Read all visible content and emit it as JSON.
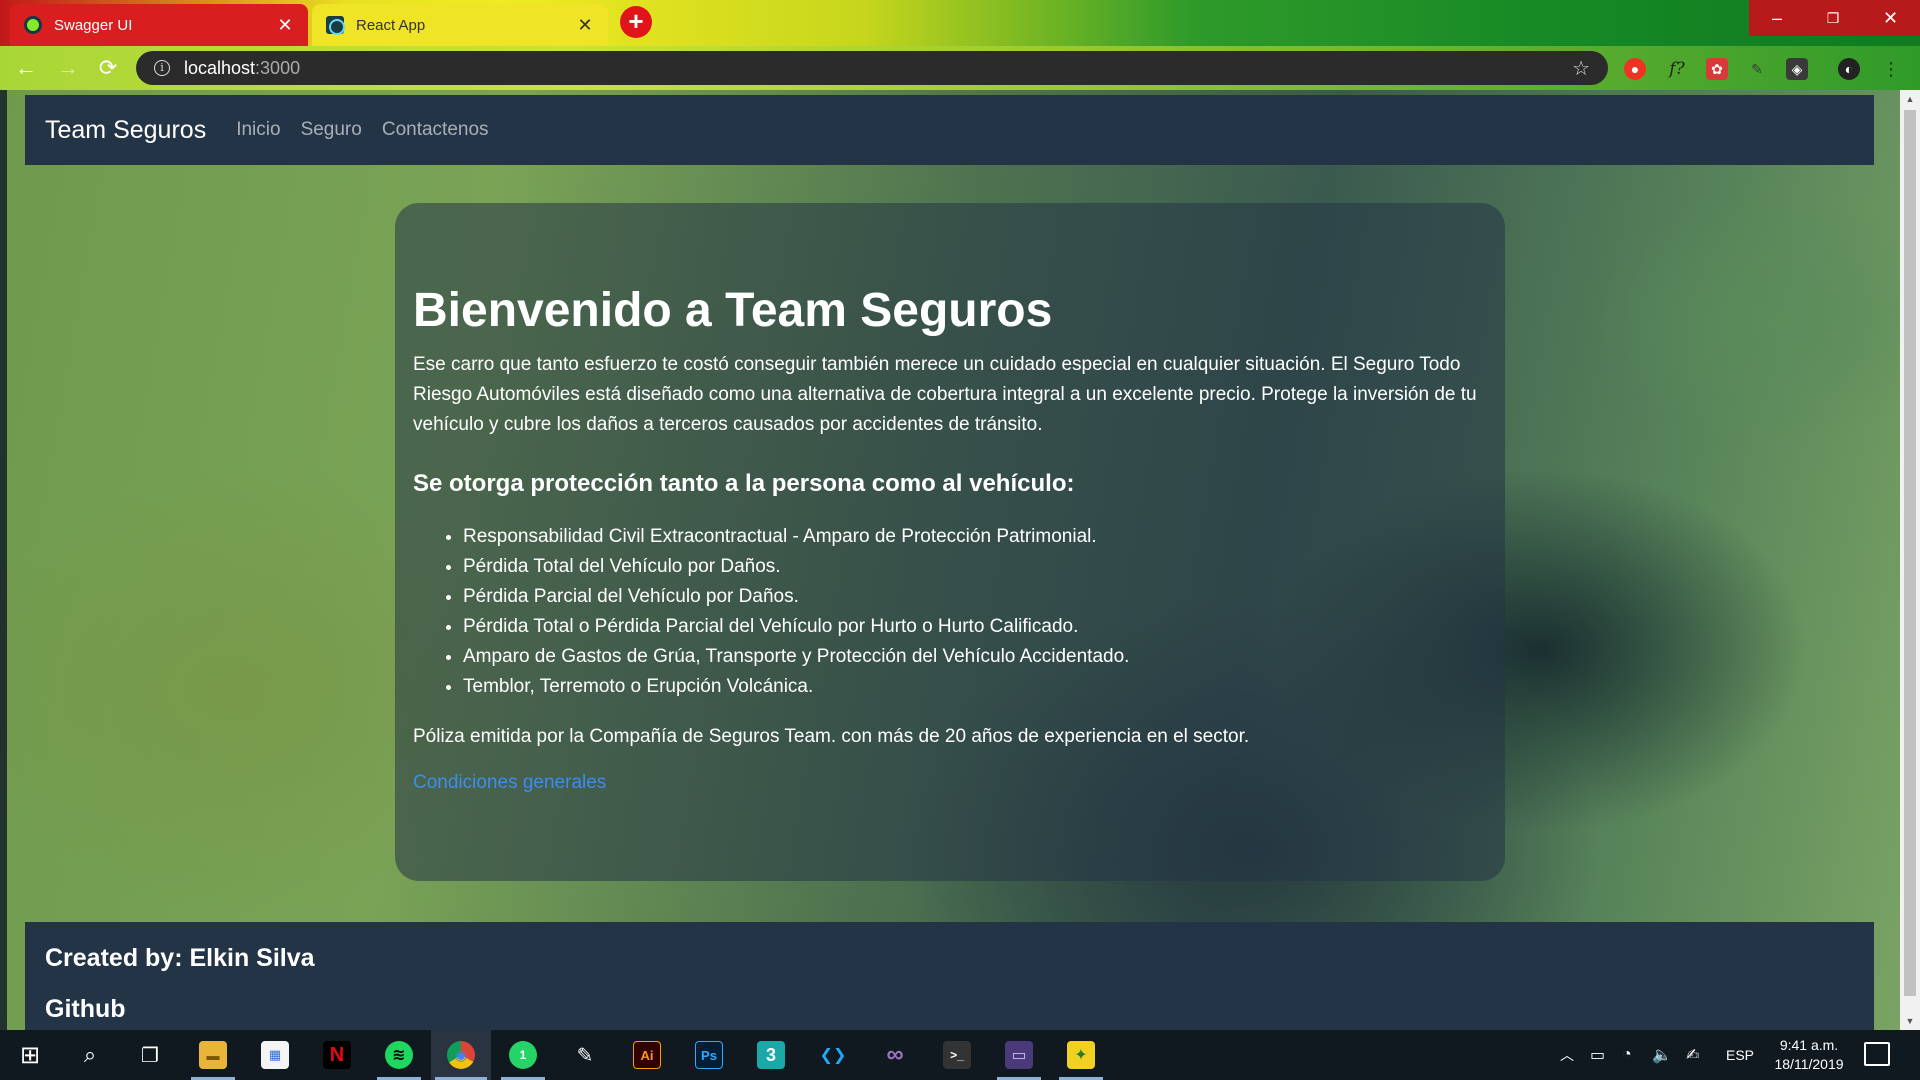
{
  "browser": {
    "tabs": [
      {
        "title": "Swagger UI",
        "icon": "swagger-icon",
        "active": false
      },
      {
        "title": "React App",
        "icon": "react-icon",
        "active": true
      }
    ],
    "new_tab_label": "+",
    "url_host": "localhost",
    "url_port": ":3000",
    "window_controls": {
      "minimize": "–",
      "maximize": "❐",
      "close": "✕"
    },
    "nav": {
      "back": "←",
      "forward": "→",
      "reload": "⟳",
      "info": "i",
      "bookmark": "☆"
    },
    "extensions": [
      "adblock-icon",
      "f?",
      "puzzle-extension-icon",
      "pen-extension-icon",
      "bulb-extension-icon",
      "profile-icon",
      "menu-icon"
    ],
    "extension_glyphs": {
      "ext2": "f?",
      "menu": "⋮"
    }
  },
  "site": {
    "brand": "Team Seguros",
    "nav_links": [
      "Inicio",
      "Seguro",
      "Contactenos"
    ],
    "hero": {
      "title": "Bienvenido a Team Seguros",
      "lead": "Ese carro que tanto esfuerzo te costó conseguir también merece un cuidado especial en cualquier situación. El Seguro Todo Riesgo Automóviles está diseñado como una alternativa de cobertura integral a un excelente precio. Protege la inversión de tu vehículo y cubre los daños a terceros causados por accidentes de tránsito.",
      "subtitle": "Se otorga protección tanto a la persona como al vehículo:",
      "coverage": [
        "Responsabilidad Civil Extracontractual - Amparo de Protección Patrimonial.",
        "Pérdida Total del Vehículo por Daños.",
        "Pérdida Parcial del Vehículo por Daños.",
        "Pérdida Total o Pérdida Parcial del Vehículo por Hurto o Hurto Calificado.",
        "Amparo de Gastos de Grúa, Transporte y Protección del Vehículo Accidentado.",
        "Temblor, Terremoto o Erupción Volcánica."
      ],
      "note": "Póliza emitida por la Compañía de Seguros Team. con más de 20 años de experiencia en el sector.",
      "link": "Condiciones generales"
    },
    "footer": {
      "credit": "Created by: Elkin Silva",
      "github": "Github"
    }
  },
  "taskbar": {
    "apps": [
      {
        "name": "start-icon",
        "glyph": "⊞"
      },
      {
        "name": "search-icon",
        "glyph": "⌕"
      },
      {
        "name": "task-view-icon",
        "glyph": "❐"
      },
      {
        "name": "file-explorer-icon",
        "glyph": "▬"
      },
      {
        "name": "store-icon",
        "glyph": "▦"
      },
      {
        "name": "netflix-icon",
        "glyph": "N"
      },
      {
        "name": "spotify-icon",
        "glyph": "≋"
      },
      {
        "name": "chrome-icon",
        "glyph": "◉"
      },
      {
        "name": "whatsapp-icon",
        "glyph": "1"
      },
      {
        "name": "inkscape-icon",
        "glyph": "✎"
      },
      {
        "name": "illustrator-icon",
        "glyph": "Ai"
      },
      {
        "name": "photoshop-icon",
        "glyph": "Ps"
      },
      {
        "name": "3dsmax-icon",
        "glyph": "3"
      },
      {
        "name": "vscode-icon",
        "glyph": "❮❯"
      },
      {
        "name": "visual-studio-icon",
        "glyph": "∞"
      },
      {
        "name": "terminal-icon",
        "glyph": ">_"
      },
      {
        "name": "console-icon",
        "glyph": "▭"
      },
      {
        "name": "sticky-tool-icon",
        "glyph": "✦"
      }
    ],
    "tray": {
      "chevron": "︿",
      "language": "ESP",
      "time": "9:41 a.m.",
      "date": "18/11/2019"
    }
  }
}
